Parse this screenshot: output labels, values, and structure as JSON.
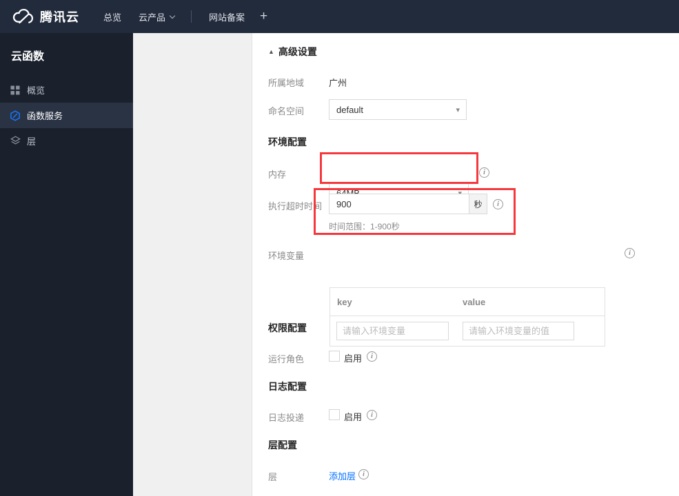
{
  "icons": {
    "caret_down": "▾",
    "collapse_up": "▲",
    "info": "i"
  },
  "topnav": {
    "brand": "腾讯云",
    "overview": "总览",
    "products": "云产品",
    "beian": "网站备案",
    "plus": "+"
  },
  "sidebar": {
    "title": "云函数",
    "items": [
      {
        "label": "概览"
      },
      {
        "label": "函数服务"
      },
      {
        "label": "层"
      }
    ]
  },
  "content": {
    "advanced": "高级设置",
    "region_label": "所属地域",
    "region_value": "广州",
    "namespace_label": "命名空间",
    "namespace_value": "default",
    "env_section": "环境配置",
    "memory_label": "内存",
    "memory_value": "64MB",
    "timeout_label": "执行超时时间",
    "timeout_value": "900",
    "timeout_unit": "秒",
    "timeout_hint": "时间范围：1-900秒",
    "envvar_label": "环境变量",
    "envvar_key_header": "key",
    "envvar_value_header": "value",
    "envvar_key_placeholder": "请输入环境变量",
    "envvar_value_placeholder": "请输入环境变量的值",
    "perm_section": "权限配置",
    "role_label": "运行角色",
    "enable_label": "启用",
    "log_section": "日志配置",
    "logship_label": "日志投递",
    "layer_section": "层配置",
    "layer_label": "层",
    "add_layer": "添加层"
  },
  "colors": {
    "accent_blue": "#006eff",
    "annotation_red": "#f5383d",
    "topnav_bg": "#222b3c",
    "sidebar_bg": "#1a202c",
    "sidebar_active_bg": "#2a3344"
  }
}
